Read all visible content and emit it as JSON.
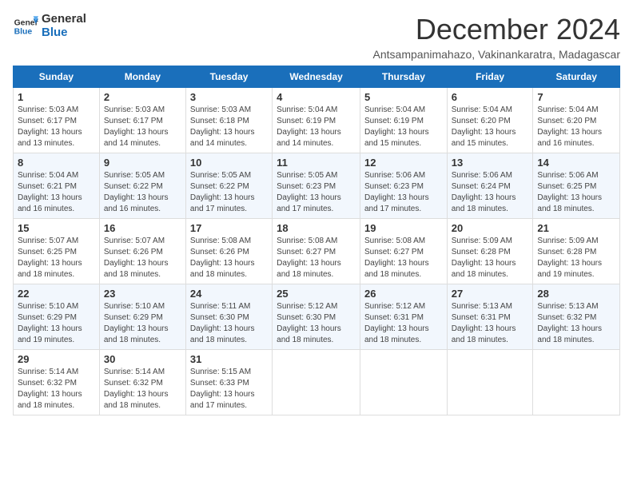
{
  "header": {
    "logo_line1": "General",
    "logo_line2": "Blue",
    "month": "December 2024",
    "location": "Antsampanimahazo, Vakinankaratra, Madagascar"
  },
  "days_of_week": [
    "Sunday",
    "Monday",
    "Tuesday",
    "Wednesday",
    "Thursday",
    "Friday",
    "Saturday"
  ],
  "weeks": [
    [
      {
        "day": "1",
        "info": "Sunrise: 5:03 AM\nSunset: 6:17 PM\nDaylight: 13 hours and 13 minutes."
      },
      {
        "day": "2",
        "info": "Sunrise: 5:03 AM\nSunset: 6:17 PM\nDaylight: 13 hours and 14 minutes."
      },
      {
        "day": "3",
        "info": "Sunrise: 5:03 AM\nSunset: 6:18 PM\nDaylight: 13 hours and 14 minutes."
      },
      {
        "day": "4",
        "info": "Sunrise: 5:04 AM\nSunset: 6:19 PM\nDaylight: 13 hours and 14 minutes."
      },
      {
        "day": "5",
        "info": "Sunrise: 5:04 AM\nSunset: 6:19 PM\nDaylight: 13 hours and 15 minutes."
      },
      {
        "day": "6",
        "info": "Sunrise: 5:04 AM\nSunset: 6:20 PM\nDaylight: 13 hours and 15 minutes."
      },
      {
        "day": "7",
        "info": "Sunrise: 5:04 AM\nSunset: 6:20 PM\nDaylight: 13 hours and 16 minutes."
      }
    ],
    [
      {
        "day": "8",
        "info": "Sunrise: 5:04 AM\nSunset: 6:21 PM\nDaylight: 13 hours and 16 minutes."
      },
      {
        "day": "9",
        "info": "Sunrise: 5:05 AM\nSunset: 6:22 PM\nDaylight: 13 hours and 16 minutes."
      },
      {
        "day": "10",
        "info": "Sunrise: 5:05 AM\nSunset: 6:22 PM\nDaylight: 13 hours and 17 minutes."
      },
      {
        "day": "11",
        "info": "Sunrise: 5:05 AM\nSunset: 6:23 PM\nDaylight: 13 hours and 17 minutes."
      },
      {
        "day": "12",
        "info": "Sunrise: 5:06 AM\nSunset: 6:23 PM\nDaylight: 13 hours and 17 minutes."
      },
      {
        "day": "13",
        "info": "Sunrise: 5:06 AM\nSunset: 6:24 PM\nDaylight: 13 hours and 18 minutes."
      },
      {
        "day": "14",
        "info": "Sunrise: 5:06 AM\nSunset: 6:25 PM\nDaylight: 13 hours and 18 minutes."
      }
    ],
    [
      {
        "day": "15",
        "info": "Sunrise: 5:07 AM\nSunset: 6:25 PM\nDaylight: 13 hours and 18 minutes."
      },
      {
        "day": "16",
        "info": "Sunrise: 5:07 AM\nSunset: 6:26 PM\nDaylight: 13 hours and 18 minutes."
      },
      {
        "day": "17",
        "info": "Sunrise: 5:08 AM\nSunset: 6:26 PM\nDaylight: 13 hours and 18 minutes."
      },
      {
        "day": "18",
        "info": "Sunrise: 5:08 AM\nSunset: 6:27 PM\nDaylight: 13 hours and 18 minutes."
      },
      {
        "day": "19",
        "info": "Sunrise: 5:08 AM\nSunset: 6:27 PM\nDaylight: 13 hours and 18 minutes."
      },
      {
        "day": "20",
        "info": "Sunrise: 5:09 AM\nSunset: 6:28 PM\nDaylight: 13 hours and 18 minutes."
      },
      {
        "day": "21",
        "info": "Sunrise: 5:09 AM\nSunset: 6:28 PM\nDaylight: 13 hours and 19 minutes."
      }
    ],
    [
      {
        "day": "22",
        "info": "Sunrise: 5:10 AM\nSunset: 6:29 PM\nDaylight: 13 hours and 19 minutes."
      },
      {
        "day": "23",
        "info": "Sunrise: 5:10 AM\nSunset: 6:29 PM\nDaylight: 13 hours and 18 minutes."
      },
      {
        "day": "24",
        "info": "Sunrise: 5:11 AM\nSunset: 6:30 PM\nDaylight: 13 hours and 18 minutes."
      },
      {
        "day": "25",
        "info": "Sunrise: 5:12 AM\nSunset: 6:30 PM\nDaylight: 13 hours and 18 minutes."
      },
      {
        "day": "26",
        "info": "Sunrise: 5:12 AM\nSunset: 6:31 PM\nDaylight: 13 hours and 18 minutes."
      },
      {
        "day": "27",
        "info": "Sunrise: 5:13 AM\nSunset: 6:31 PM\nDaylight: 13 hours and 18 minutes."
      },
      {
        "day": "28",
        "info": "Sunrise: 5:13 AM\nSunset: 6:32 PM\nDaylight: 13 hours and 18 minutes."
      }
    ],
    [
      {
        "day": "29",
        "info": "Sunrise: 5:14 AM\nSunset: 6:32 PM\nDaylight: 13 hours and 18 minutes."
      },
      {
        "day": "30",
        "info": "Sunrise: 5:14 AM\nSunset: 6:32 PM\nDaylight: 13 hours and 18 minutes."
      },
      {
        "day": "31",
        "info": "Sunrise: 5:15 AM\nSunset: 6:33 PM\nDaylight: 13 hours and 17 minutes."
      },
      null,
      null,
      null,
      null
    ]
  ]
}
